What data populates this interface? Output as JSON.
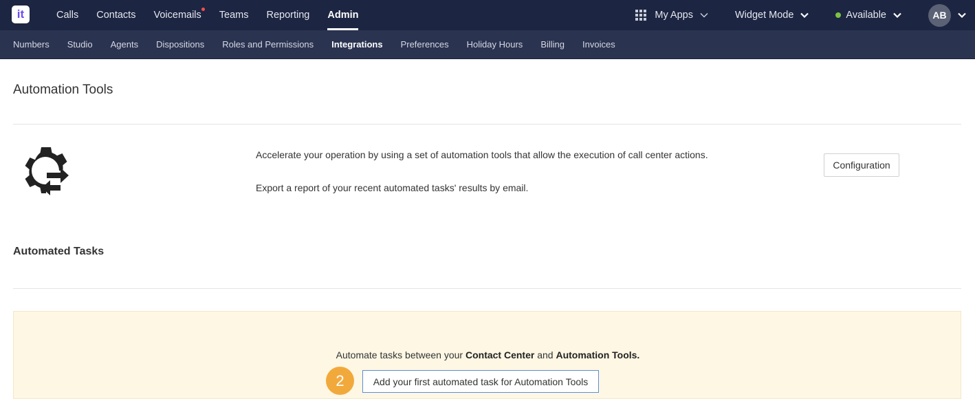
{
  "app": {
    "logo_text": "it",
    "accent_color": "#6a4cf5"
  },
  "topnav": {
    "items": [
      {
        "label": "Calls"
      },
      {
        "label": "Contacts"
      },
      {
        "label": "Voicemails",
        "notification": true
      },
      {
        "label": "Teams"
      },
      {
        "label": "Reporting"
      },
      {
        "label": "Admin",
        "active": true
      }
    ],
    "my_apps": "My Apps",
    "widget_mode": "Widget Mode",
    "status": "Available",
    "status_color": "#7cc243",
    "avatar_initials": "AB"
  },
  "subnav": {
    "items": [
      {
        "label": "Numbers"
      },
      {
        "label": "Studio"
      },
      {
        "label": "Agents"
      },
      {
        "label": "Dispositions"
      },
      {
        "label": "Roles and Permissions"
      },
      {
        "label": "Integrations",
        "active": true
      },
      {
        "label": "Preferences"
      },
      {
        "label": "Holiday Hours"
      },
      {
        "label": "Billing"
      },
      {
        "label": "Invoices"
      }
    ]
  },
  "main": {
    "title": "Automation Tools",
    "icon": "gear-sync-icon",
    "description_1": "Accelerate your operation by using a set of automation tools that allow the execution of call center actions.",
    "description_2": "Export a report of your recent automated tasks' results by email.",
    "configuration_button": "Configuration"
  },
  "tasks": {
    "title": "Automated Tasks",
    "banner": {
      "text_prefix": "Automate tasks between your ",
      "bold_1": "Contact Center",
      "text_mid": " and ",
      "bold_2": "Automation Tools.",
      "step_number": "2",
      "button_label": "Add your first automated task for Automation Tools"
    }
  }
}
